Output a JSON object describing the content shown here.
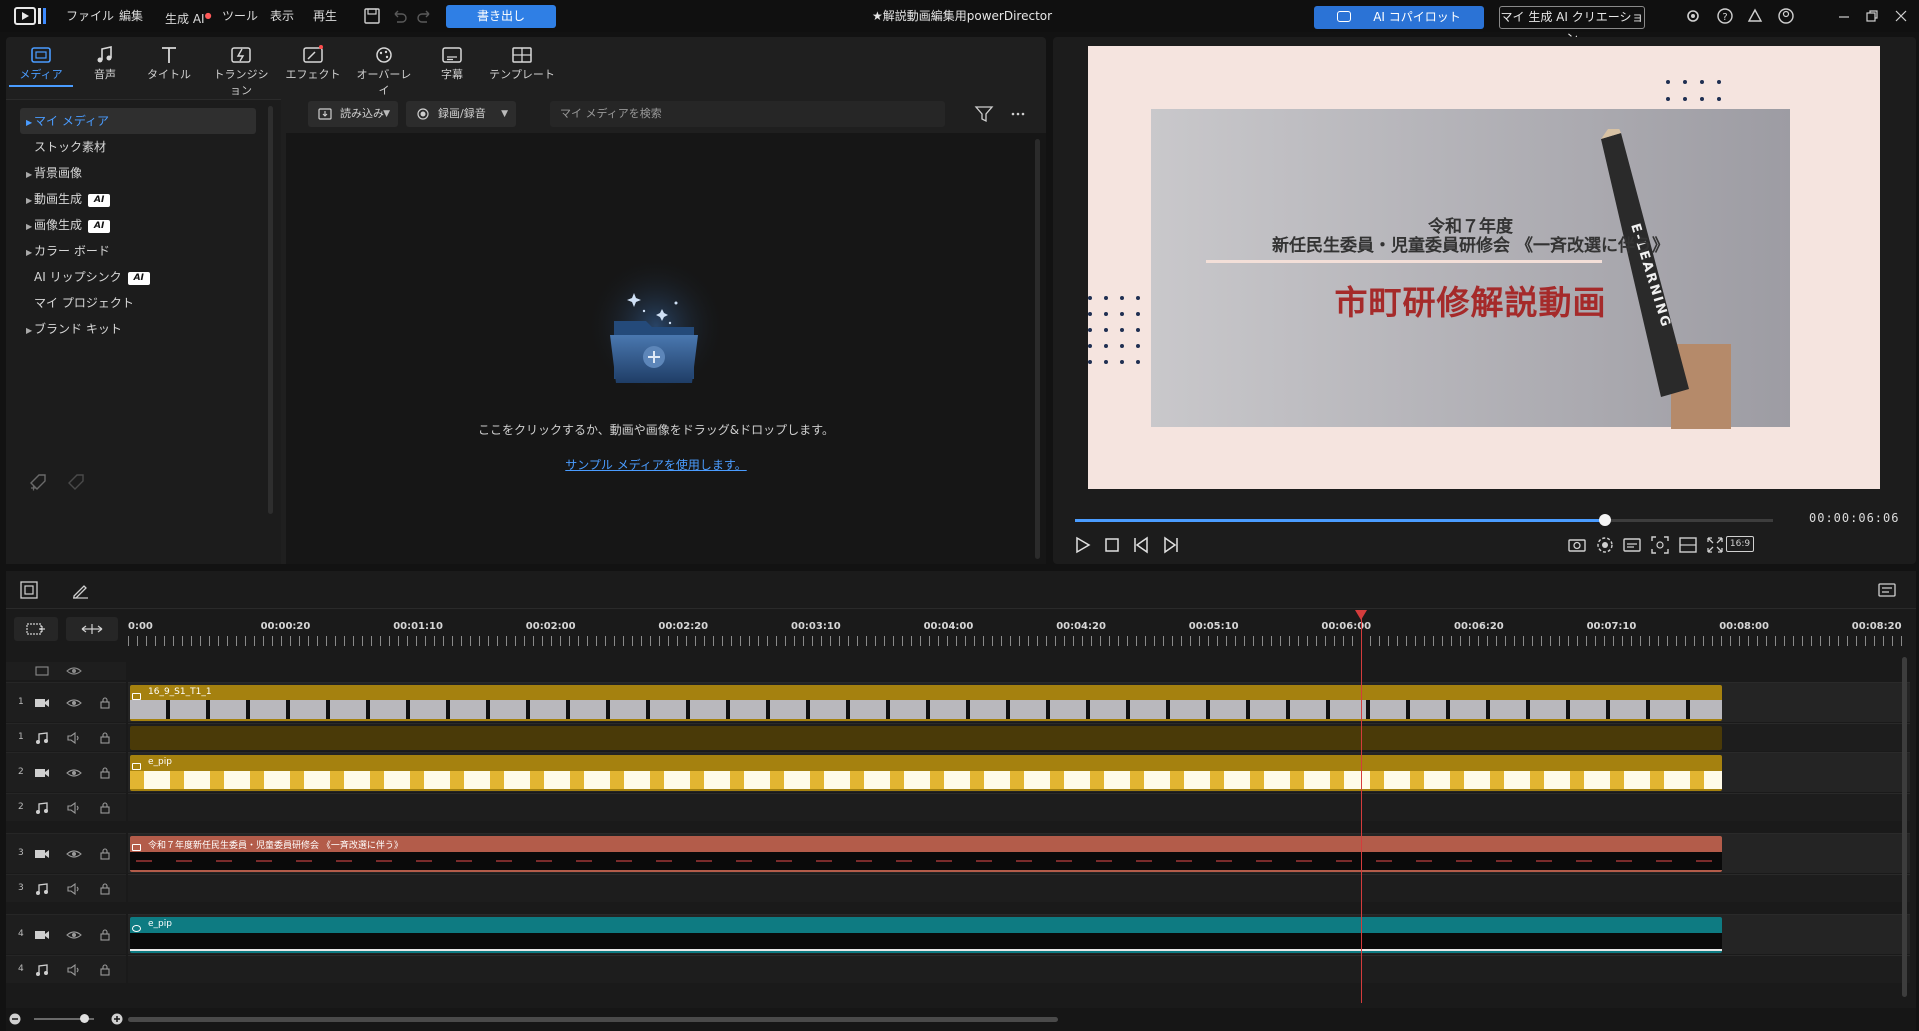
{
  "app": {
    "title": "★解説動画編集用powerDirector",
    "menus": [
      "ファイル",
      "編集",
      "生成 AI",
      "ツール",
      "表示",
      "再生"
    ],
    "export_label": "書き出し",
    "copilot_label": "AI コパイロット",
    "creation_label": "マイ 生成 AI クリエーション"
  },
  "media_room": {
    "tabs": [
      {
        "label": "メディア",
        "icon": "media-icon"
      },
      {
        "label": "音声",
        "icon": "music-note-icon"
      },
      {
        "label": "タイトル",
        "icon": "title-icon"
      },
      {
        "label": "トランジション",
        "icon": "transition-icon"
      },
      {
        "label": "エフェクト",
        "icon": "effect-icon"
      },
      {
        "label": "オーバーレイ",
        "icon": "overlay-icon"
      },
      {
        "label": "字幕",
        "icon": "subtitle-icon"
      },
      {
        "label": "テンプレート",
        "icon": "template-icon"
      }
    ],
    "sidebar": [
      {
        "label": "マイ メディア",
        "arrow": true,
        "ai": false
      },
      {
        "label": "ストック素材",
        "arrow": false,
        "ai": false
      },
      {
        "label": "背景画像",
        "arrow": true,
        "ai": false
      },
      {
        "label": "動画生成",
        "arrow": true,
        "ai": true
      },
      {
        "label": "画像生成",
        "arrow": true,
        "ai": true
      },
      {
        "label": "カラー ボード",
        "arrow": true,
        "ai": false
      },
      {
        "label": "AI リップシンク",
        "arrow": false,
        "ai": true
      },
      {
        "label": "マイ プロジェクト",
        "arrow": false,
        "ai": false
      },
      {
        "label": "ブランド キット",
        "arrow": true,
        "ai": false
      }
    ],
    "ai_badge": "AI",
    "import_label": "読み込み",
    "record_label": "録画/録音",
    "search_placeholder": "マイ メディアを検索",
    "empty_text": "ここをクリックするか、動画や画像をドラッグ&ドロップします。",
    "sample_link": "サンプル メディアを使用します。"
  },
  "preview": {
    "slide_line1": "令和７年度",
    "slide_line2": "新任民生委員・児童委員研修会 《一斉改選に伴う》",
    "slide_main": "市町研修解説動画",
    "pencil_text": "E-LEARNING",
    "timecode": "00:00:06:06",
    "progress": 0.76,
    "aspect": "16:9"
  },
  "timeline": {
    "ruler": [
      "0:00",
      "00:00:20",
      "00:01:10",
      "00:02:00",
      "00:02:20",
      "00:03:10",
      "00:04:00",
      "00:04:20",
      "00:05:10",
      "00:06:00",
      "00:06:20",
      "00:07:10",
      "00:08:00",
      "00:08:20"
    ],
    "tracks": [
      {
        "num": "1",
        "type": "video",
        "clip": "16_9_S1_T1_1",
        "color": "#a5810f"
      },
      {
        "num": "1",
        "type": "audio",
        "clip": "",
        "color": "#4a3a08"
      },
      {
        "num": "2",
        "type": "video",
        "clip": "e_pip",
        "color": "#a5810f"
      },
      {
        "num": "2",
        "type": "audio",
        "clip": "",
        "color": ""
      },
      {
        "num": "3",
        "type": "video",
        "clip": "令和７年度新任民生委員・児童委員研修会 《一斉改選に伴う》",
        "color": "#b35c4a"
      },
      {
        "num": "3",
        "type": "audio",
        "clip": "",
        "color": ""
      },
      {
        "num": "4",
        "type": "video",
        "clip": "e_pip",
        "color": "#0e7b82"
      },
      {
        "num": "4",
        "type": "audio",
        "clip": "",
        "color": ""
      }
    ]
  }
}
